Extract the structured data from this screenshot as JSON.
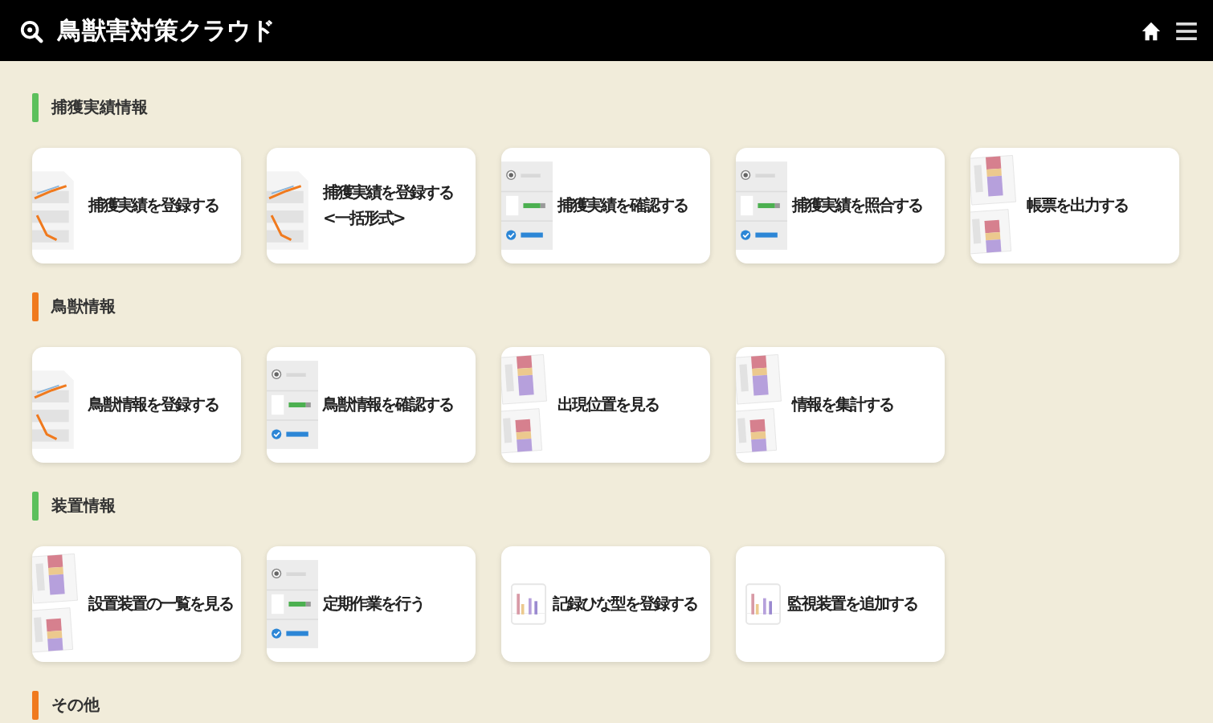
{
  "header": {
    "title": "鳥獣害対策クラウド"
  },
  "sections": [
    {
      "title": "捕獲実績情報",
      "color": "#5cc05c",
      "cards": [
        {
          "kind": "line",
          "lines": [
            "捕獲実績を登録する"
          ]
        },
        {
          "kind": "line",
          "lines": [
            "捕獲実績を登録する",
            "<一括形式>"
          ]
        },
        {
          "kind": "list",
          "lines": [
            "捕獲実績を確認する"
          ]
        },
        {
          "kind": "list",
          "lines": [
            "捕獲実績を照合する"
          ]
        },
        {
          "kind": "report",
          "lines": [
            "帳票を出力する"
          ]
        }
      ]
    },
    {
      "title": "鳥獣情報",
      "color": "#f07a1e",
      "cards": [
        {
          "kind": "line",
          "lines": [
            "鳥獣情報を登録する"
          ]
        },
        {
          "kind": "list",
          "lines": [
            "鳥獣情報を確認する"
          ]
        },
        {
          "kind": "report",
          "lines": [
            "出現位置を見る"
          ]
        },
        {
          "kind": "report",
          "lines": [
            "情報を集計する"
          ]
        }
      ]
    },
    {
      "title": "装置情報",
      "color": "#5cc05c",
      "cards": [
        {
          "kind": "report",
          "lines": [
            "設置装置の一覧を見る"
          ]
        },
        {
          "kind": "list",
          "lines": [
            "定期作業を行う"
          ]
        },
        {
          "kind": "bars",
          "lines": [
            "記録ひな型を登録する"
          ]
        },
        {
          "kind": "bars",
          "lines": [
            "監視装置を追加する"
          ]
        }
      ]
    },
    {
      "title": "その他",
      "color": "#f07a1e"
    }
  ]
}
